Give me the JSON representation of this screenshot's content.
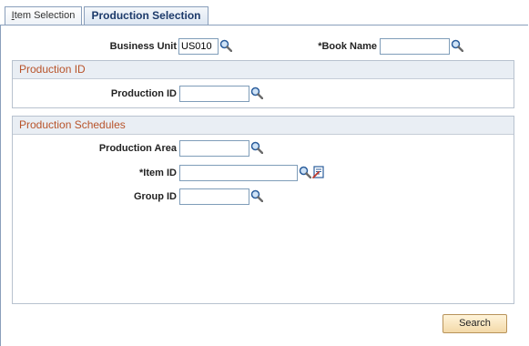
{
  "tabs": {
    "item_selection_accel": "I",
    "item_selection_rest": "tem Selection",
    "production_selection": "Production Selection"
  },
  "header_fields": {
    "business_unit_label": "Business Unit",
    "business_unit_value": "US010",
    "book_name_label": "*Book Name",
    "book_name_value": ""
  },
  "production_id_group": {
    "title": "Production ID",
    "production_id_label": "Production ID",
    "production_id_value": ""
  },
  "production_schedules_group": {
    "title": "Production Schedules",
    "production_area_label": "Production Area",
    "production_area_value": "",
    "item_id_label": "*Item ID",
    "item_id_value": "",
    "group_id_label": "Group ID",
    "group_id_value": ""
  },
  "actions": {
    "search_label": "Search"
  },
  "colors": {
    "group_title": "#b8532a",
    "tab_border": "#8a9fbb",
    "button_fill": "#f3d9a8"
  }
}
